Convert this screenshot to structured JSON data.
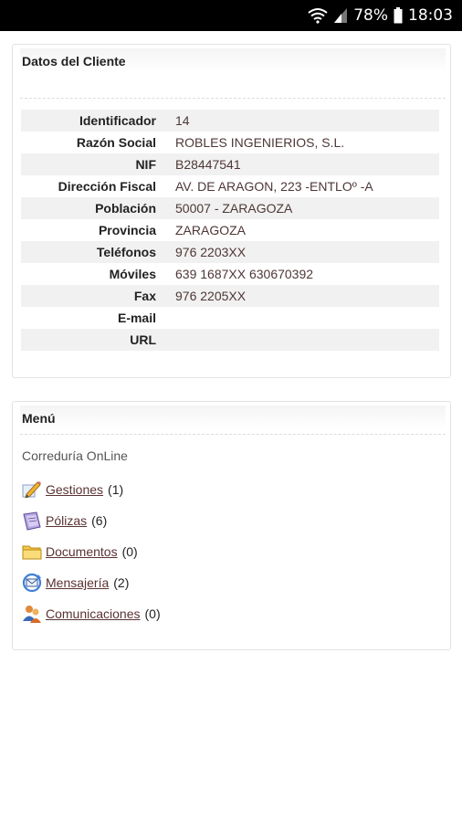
{
  "statusbar": {
    "battery": "78%",
    "time": "18:03"
  },
  "client_panel": {
    "title": "Datos del Cliente",
    "rows": [
      {
        "label": "Identificador",
        "value": "14"
      },
      {
        "label": "Razón Social",
        "value": "ROBLES INGENIERIOS, S.L."
      },
      {
        "label": "NIF",
        "value": "B28447541"
      },
      {
        "label": "Dirección Fiscal",
        "value": "AV. DE ARAGON, 223 -ENTLOº -A"
      },
      {
        "label": "Población",
        "value": "50007 - ZARAGOZA"
      },
      {
        "label": "Provincia",
        "value": "ZARAGOZA"
      },
      {
        "label": "Teléfonos",
        "value": "976 2203XX"
      },
      {
        "label": "Móviles",
        "value": "639 1687XX 630670392"
      },
      {
        "label": "Fax",
        "value": "976 2205XX"
      },
      {
        "label": "E-mail",
        "value": ""
      },
      {
        "label": "URL",
        "value": ""
      }
    ]
  },
  "menu_panel": {
    "title": "Menú",
    "section": "Correduría OnLine",
    "items": [
      {
        "label": "Gestiones",
        "count": "(1)",
        "icon": "pencil-icon"
      },
      {
        "label": "Pólizas",
        "count": "(6)",
        "icon": "policy-document-icon"
      },
      {
        "label": "Documentos",
        "count": "(0)",
        "icon": "folder-icon"
      },
      {
        "label": "Mensajería",
        "count": "(2)",
        "icon": "mail-sync-icon"
      },
      {
        "label": "Comunicaciones",
        "count": "(0)",
        "icon": "users-icon"
      }
    ]
  }
}
